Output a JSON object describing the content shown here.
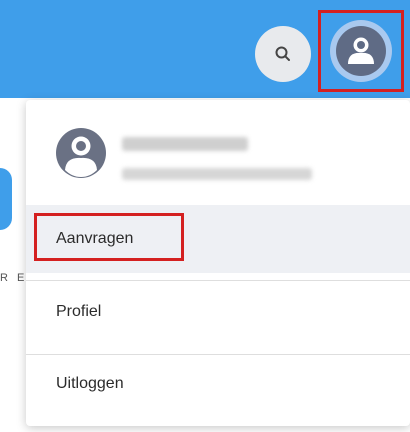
{
  "topbar": {
    "search_icon": "search-icon",
    "profile_icon": "user-avatar-icon",
    "accent": "#3f9eea",
    "highlight": "#d42020"
  },
  "background": {
    "partial_text": "R E"
  },
  "menu": {
    "user": {
      "avatar_icon": "user-avatar-icon"
    },
    "items": [
      {
        "label": "Aanvragen"
      },
      {
        "label": "Profiel"
      },
      {
        "label": "Uitloggen"
      }
    ]
  }
}
